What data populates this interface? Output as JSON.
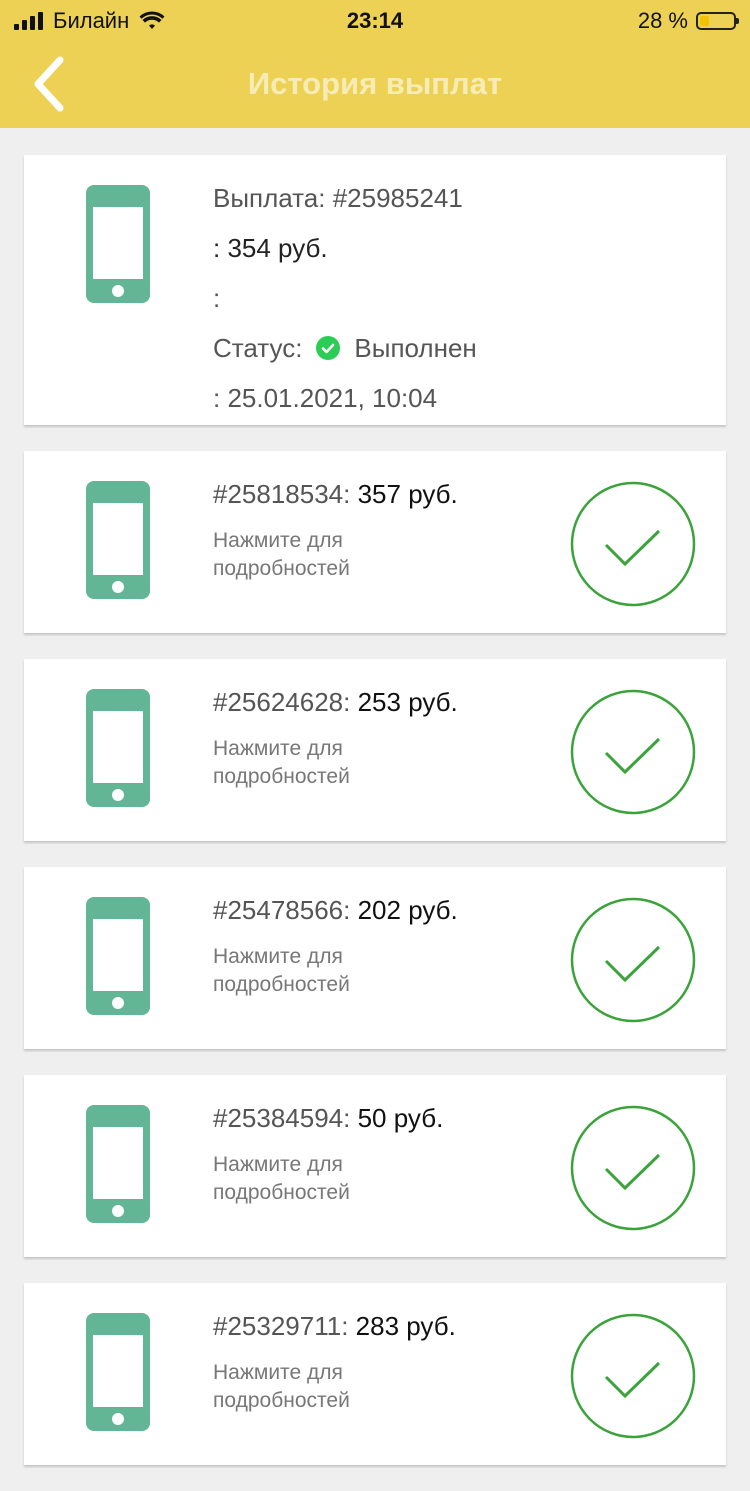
{
  "status_bar": {
    "carrier": "Билайн",
    "time": "23:14",
    "battery_percent": "28 %",
    "battery_level": 0.28
  },
  "header": {
    "title": "История выплат",
    "back_icon": "chevron-left-icon"
  },
  "colors": {
    "header_bg": "#edd155",
    "phone_icon": "#62b595",
    "check_green": "#3aa33a",
    "status_ok": "#2bcd55"
  },
  "expanded": {
    "line1": "Выплата: #25985241",
    "line2": ": 354 руб.",
    "line3": ":",
    "status_label": "Статус:",
    "status_value": "Выполнен",
    "line5": ": 25.01.2021, 10:04"
  },
  "items": [
    {
      "id": "#25818534:",
      "amount": " 357 руб.",
      "hint": "Нажмите для подробностей"
    },
    {
      "id": "#25624628:",
      "amount": " 253 руб.",
      "hint": "Нажмите для подробностей"
    },
    {
      "id": "#25478566:",
      "amount": " 202 руб.",
      "hint": "Нажмите для подробностей"
    },
    {
      "id": "#25384594:",
      "amount": " 50 руб.",
      "hint": "Нажмите для подробностей"
    },
    {
      "id": "#25329711:",
      "amount": " 283 руб.",
      "hint": "Нажмите для подробностей"
    }
  ]
}
